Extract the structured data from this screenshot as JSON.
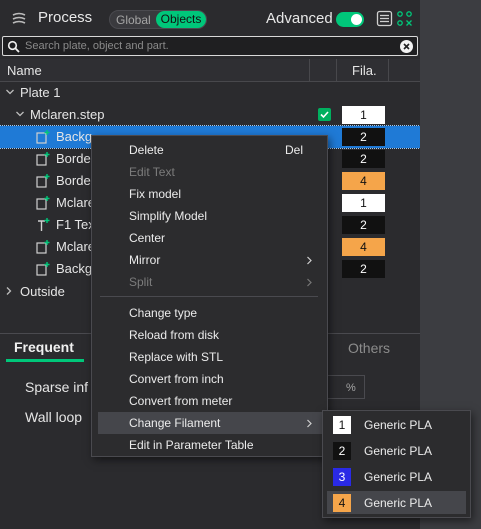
{
  "header": {
    "title": "Process",
    "mode_global": "Global",
    "mode_objects": "Objects",
    "advanced_label": "Advanced",
    "advanced_on": true,
    "accent_color": "#00c77a"
  },
  "search": {
    "placeholder": "Search plate, object and part."
  },
  "tree": {
    "columns": {
      "name": "Name",
      "filament": "Fila."
    },
    "plate": "Plate 1",
    "object": {
      "name": "Mclaren.step",
      "filament": "1"
    },
    "parts": [
      {
        "label": "Background Parts",
        "visible_label": "Backg",
        "filament": "2",
        "selected": true
      },
      {
        "label": "Borde",
        "filament": "2"
      },
      {
        "label": "Borde",
        "filament": "4"
      },
      {
        "label": "Mclare",
        "filament": "1"
      },
      {
        "label": "F1 Tex",
        "filament": "2"
      },
      {
        "label": "Mclare",
        "filament": "4"
      },
      {
        "label": "Backg",
        "filament": "2"
      }
    ],
    "outside": "Outside"
  },
  "tabs": {
    "frequent": "Frequent",
    "others": "Others"
  },
  "params": {
    "sparse": "Sparse inf",
    "wall": "Wall loop",
    "unit": "%"
  },
  "context_menu": {
    "items": [
      {
        "label": "Delete",
        "shortcut": "Del",
        "disabled": false
      },
      {
        "label": "Edit Text",
        "disabled": true
      },
      {
        "label": "Fix model",
        "disabled": false
      },
      {
        "label": "Simplify Model",
        "disabled": false
      },
      {
        "label": "Center",
        "disabled": false
      },
      {
        "label": "Mirror",
        "disabled": false,
        "submenu": true
      },
      {
        "label": "Split",
        "disabled": true,
        "submenu": true
      },
      {
        "label": "Change type",
        "disabled": false
      },
      {
        "label": "Reload from disk",
        "disabled": false
      },
      {
        "label": "Replace with STL",
        "disabled": false
      },
      {
        "label": "Convert from inch",
        "disabled": false
      },
      {
        "label": "Convert from meter",
        "disabled": false
      },
      {
        "label": "Change Filament",
        "disabled": false,
        "submenu": true,
        "hover": true
      },
      {
        "label": "Edit in Parameter Table",
        "disabled": false
      }
    ]
  },
  "filament_submenu": [
    {
      "index": "1",
      "name": "Generic PLA",
      "color": "#ffffff",
      "text_color": "#111111"
    },
    {
      "index": "2",
      "name": "Generic PLA",
      "color": "#111111",
      "text_color": "#ffffff"
    },
    {
      "index": "3",
      "name": "Generic PLA",
      "color": "#2a2ae6",
      "text_color": "#ffffff"
    },
    {
      "index": "4",
      "name": "Generic PLA",
      "color": "#f5a54a",
      "text_color": "#111111"
    }
  ],
  "filament_colors": {
    "1": "#ffffff",
    "2": "#111111",
    "3": "#2a2ae6",
    "4": "#f5a54a"
  }
}
